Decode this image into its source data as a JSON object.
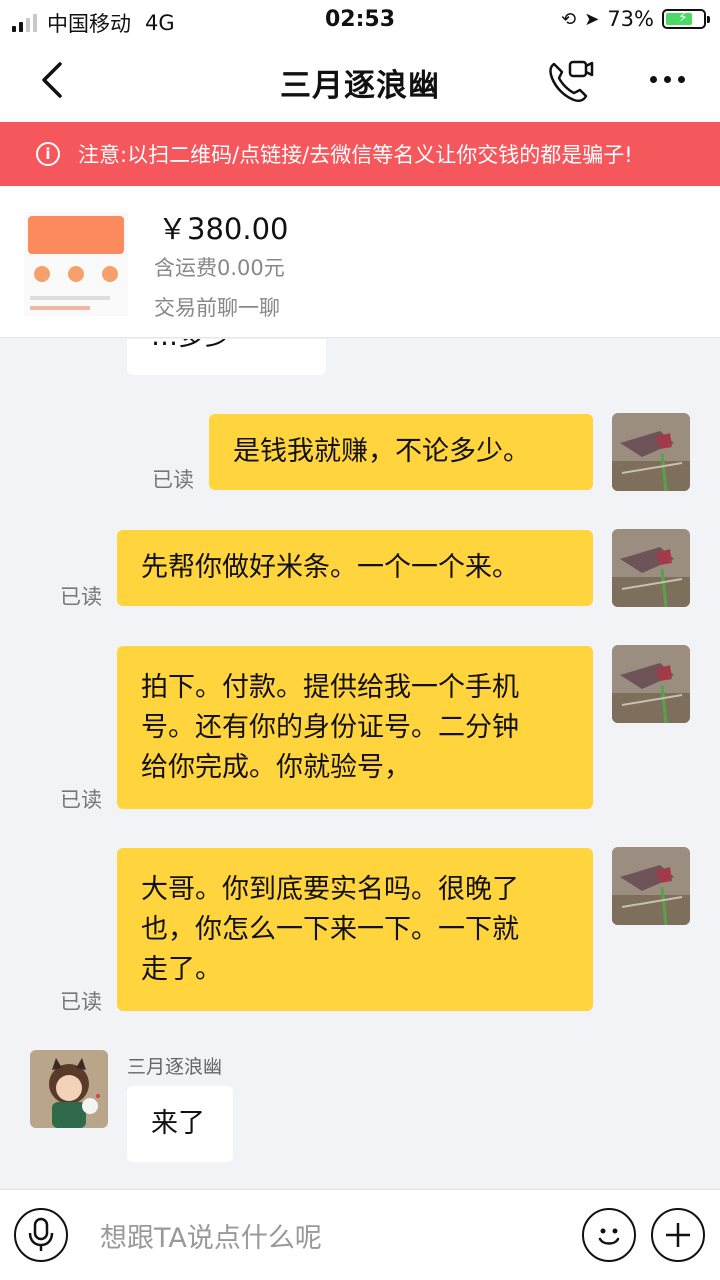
{
  "status_bar": {
    "carrier": "中国移动",
    "network": "4G",
    "time": "02:53",
    "battery_percent": "73%",
    "battery_level": 0.73
  },
  "header": {
    "title": "三月逐浪幽"
  },
  "warning": {
    "text": "注意:以扫二维码/点链接/去微信等名义让你交钱的都是骗子!"
  },
  "product": {
    "price": "￥380.00",
    "shipping": "含运费0.00元",
    "chat_prompt": "交易前聊一聊"
  },
  "messages": [
    {
      "from": "them",
      "text": "…多少"
    },
    {
      "from": "me",
      "text": "是钱我就赚，不论多少。",
      "status": "已读"
    },
    {
      "from": "me",
      "text": "先帮你做好米条。一个一个来。",
      "status": "已读"
    },
    {
      "from": "me",
      "lines": [
        "拍下。付款。提供给我一个手机",
        "号。还有你的身份证号。二分钟",
        "给你完成。你就验号，"
      ],
      "status": "已读"
    },
    {
      "from": "me",
      "lines": [
        "大哥。你到底要实名吗。很晚了",
        "也，你怎么一下来一下。一下就",
        "走了。"
      ],
      "status": "已读"
    },
    {
      "from": "them",
      "sender": "三月逐浪幽",
      "text": "来了"
    }
  ],
  "input": {
    "placeholder": "想跟TA说点什么呢"
  },
  "colors": {
    "warning_bg": "#f6575c",
    "my_bubble": "#ffd43d",
    "their_bubble": "#ffffff",
    "chat_bg": "#f2f3f6"
  }
}
